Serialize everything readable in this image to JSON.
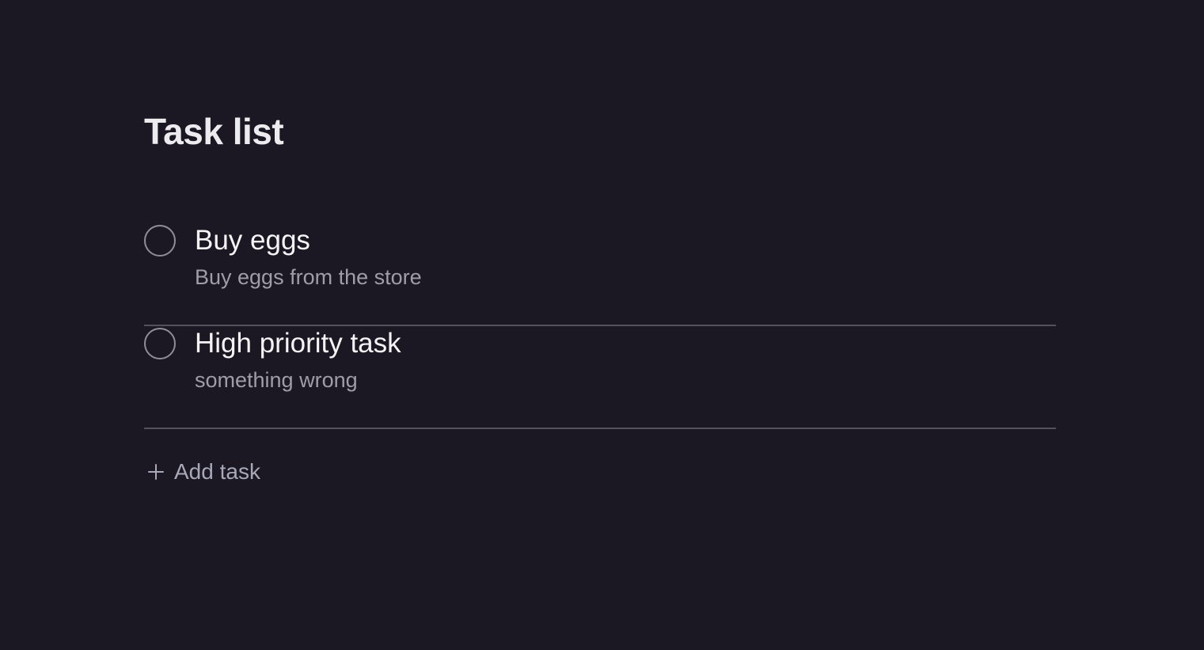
{
  "page": {
    "title": "Task list"
  },
  "tasks": [
    {
      "title": "Buy eggs",
      "description": "Buy eggs from the store",
      "completed": false
    },
    {
      "title": "High priority task",
      "description": "something wrong",
      "completed": false
    }
  ],
  "add_task": {
    "label": "Add task",
    "icon": "plus-icon"
  },
  "colors": {
    "background": "#1b1823",
    "title_text": "#ececee",
    "task_title_text": "#f4f4f6",
    "task_description_text": "#9f9da6",
    "divider": "#53515c",
    "checkbox_border": "#8f8d97",
    "add_task_text": "#a7a8b8"
  }
}
